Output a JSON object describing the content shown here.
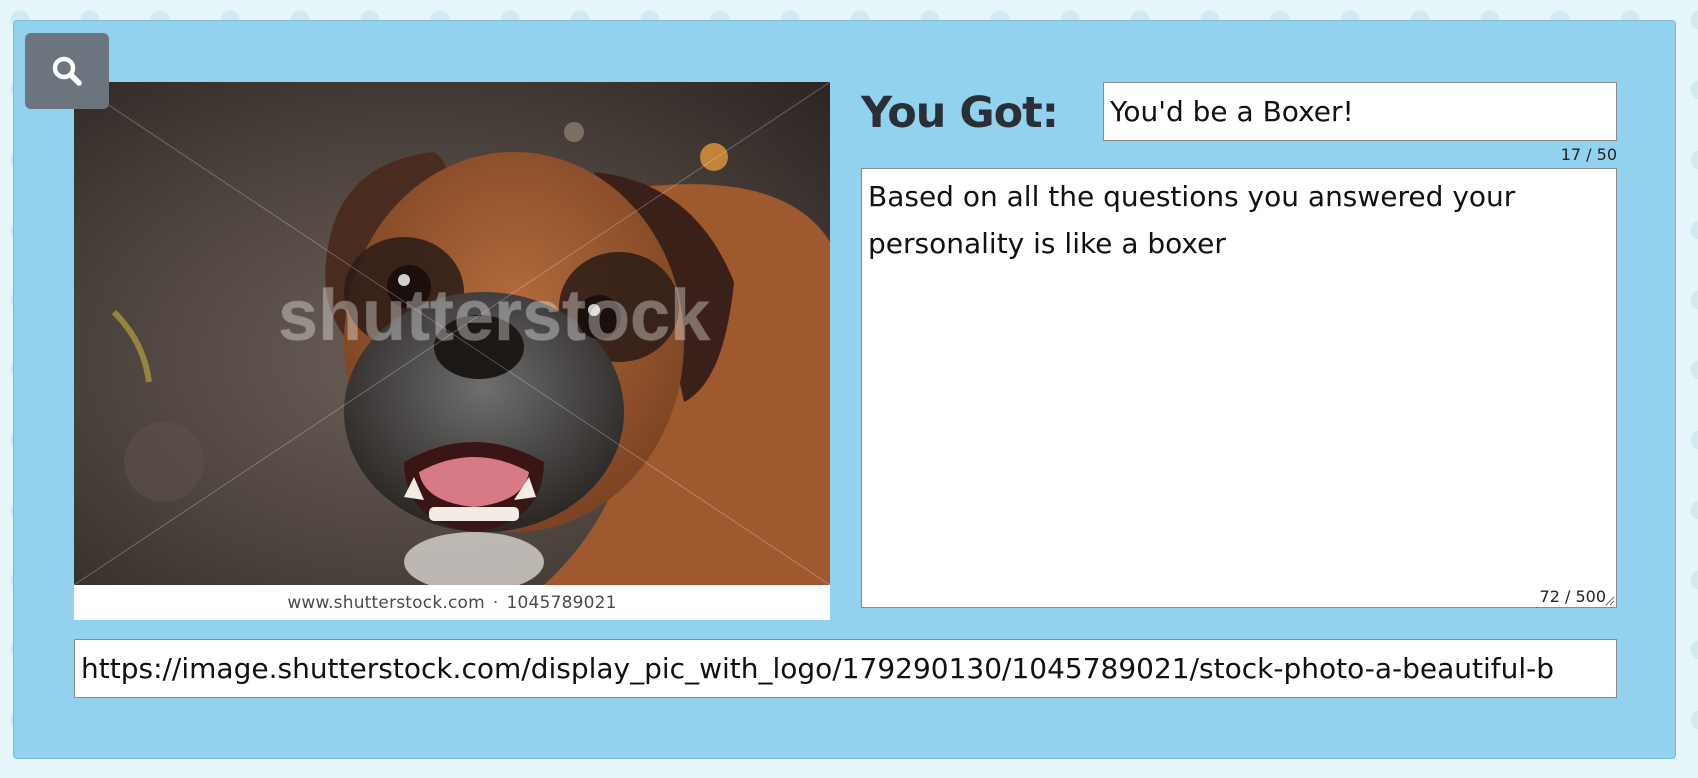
{
  "toolbar": {
    "search_icon": "search-icon"
  },
  "image": {
    "watermark": "shutterstock",
    "caption_site": "www.shutterstock.com",
    "caption_separator": "·",
    "caption_id": "1045789021",
    "url": "https://image.shutterstock.com/display_pic_with_logo/179290130/1045789021/stock-photo-a-beautiful-b"
  },
  "result": {
    "heading": "You Got:",
    "title_value": "You'd be a Boxer!",
    "title_counter": "17 / 50",
    "description_value": "Based on all the questions you answered your personality is like a boxer",
    "description_counter": "72 / 500"
  },
  "colors": {
    "panel": "#93d2ef",
    "search_button": "#6c757d",
    "page_background": "#e6f5f9"
  }
}
